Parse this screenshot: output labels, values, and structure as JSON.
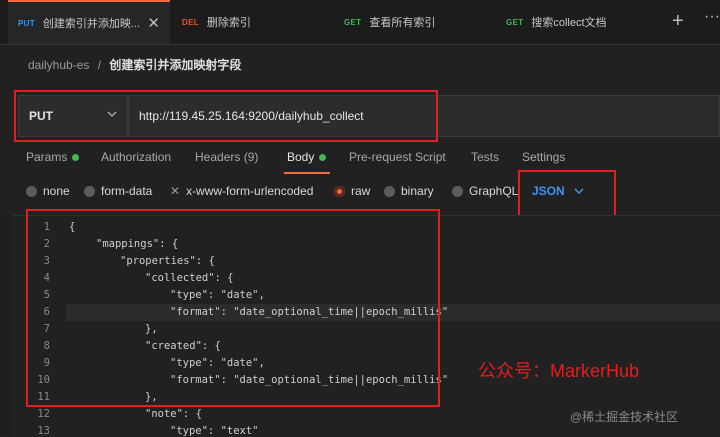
{
  "tabs": [
    {
      "method": "PUT",
      "method_color": "#3b96f5",
      "name": "创建索引并添加映..."
    },
    {
      "method": "DEL",
      "method_color": "#e0533a",
      "name": "删除索引"
    },
    {
      "method": "GET",
      "method_color": "#3fb950",
      "name": "查看所有索引"
    },
    {
      "method": "GET",
      "method_color": "#3fb950",
      "name": "搜索collect文档"
    }
  ],
  "breadcrumb": {
    "collection": "dailyhub-es",
    "separator": "/",
    "request": "创建索引并添加映射字段"
  },
  "request": {
    "method": "PUT",
    "url": "http://119.45.25.164:9200/dailyhub_collect"
  },
  "request_tabs": {
    "params": "Params",
    "authorization": "Authorization",
    "headers": "Headers (9)",
    "body": "Body",
    "prerequest": "Pre-request Script",
    "tests": "Tests",
    "settings": "Settings"
  },
  "body_types": {
    "none": "none",
    "form_data": "form-data",
    "urlencoded": "x-www-form-urlencoded",
    "raw": "raw",
    "binary": "binary",
    "graphql": "GraphQL",
    "format": "JSON"
  },
  "code_lines": [
    {
      "n": "1",
      "text": "{"
    },
    {
      "n": "2",
      "text": "\"mappings\": {"
    },
    {
      "n": "3",
      "text": "\"properties\": {"
    },
    {
      "n": "4",
      "text": "\"collected\": {"
    },
    {
      "n": "5",
      "text": "\"type\": \"date\","
    },
    {
      "n": "6",
      "text": "\"format\": \"date_optional_time||epoch_millis\""
    },
    {
      "n": "7",
      "text": "},"
    },
    {
      "n": "8",
      "text": "\"created\": {"
    },
    {
      "n": "9",
      "text": "\"type\": \"date\","
    },
    {
      "n": "10",
      "text": "\"format\": \"date_optional_time||epoch_millis\""
    },
    {
      "n": "11",
      "text": "},"
    },
    {
      "n": "12",
      "text": "\"note\": {"
    },
    {
      "n": "13",
      "text": "\"type\": \"text\""
    }
  ],
  "watermark": "公众号：MarkerHub",
  "credit": "@稀土掘金技术社区",
  "icons": {
    "add": "plus-icon",
    "more": "ellipsis-icon",
    "close": "close-icon",
    "chevron": "chevron-down-icon"
  },
  "colors": {
    "accent": "#f26b3a",
    "annotation": "#e01e1e",
    "link": "#3b96f5",
    "success": "#3fb950"
  }
}
